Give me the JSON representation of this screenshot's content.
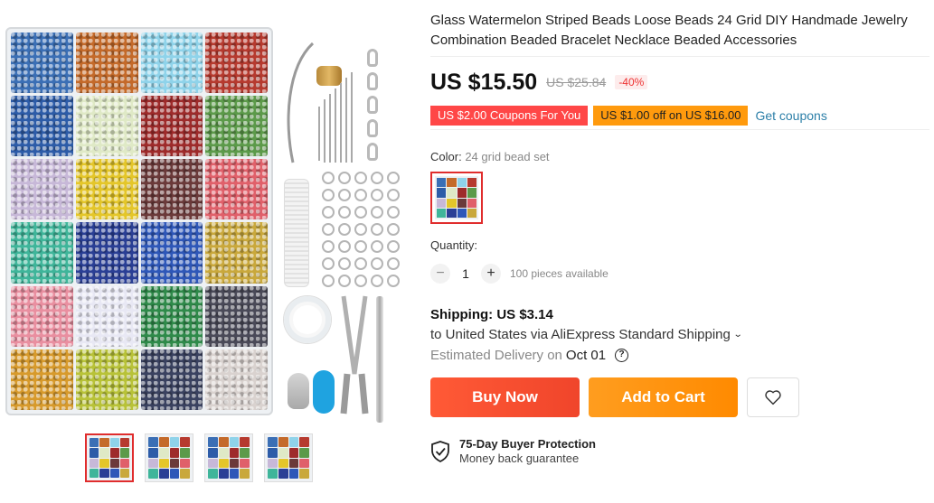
{
  "product": {
    "title": "Glass Watermelon Striped Beads Loose Beads 24 Grid DIY Handmade Jewelry Combination Beaded Bracelet Necklace Beaded Accessories",
    "price": "US $15.50",
    "original_price": "US $25.84",
    "discount": "-40%"
  },
  "coupons": {
    "coupon1": "US $2.00 Coupons For You",
    "coupon2": "US $1.00 off on US $16.00",
    "get_coupons": "Get coupons"
  },
  "color": {
    "label": "Color:",
    "value": "24 grid bead set"
  },
  "quantity": {
    "label": "Quantity:",
    "minus": "−",
    "plus": "+",
    "value": "1",
    "available": "100 pieces available"
  },
  "shipping": {
    "title": "Shipping: US $3.14",
    "destination": "to United States via AliExpress Standard Shipping",
    "delivery_label": "Estimated Delivery on",
    "delivery_date": "Oct 01",
    "help": "?"
  },
  "actions": {
    "buy_now": "Buy Now",
    "add_to_cart": "Add to Cart"
  },
  "protection": {
    "title": "75-Day Buyer Protection",
    "subtitle": "Money back guarantee"
  },
  "colors": {
    "accent_red": "#ff4747",
    "accent_orange": "#ff9a0d",
    "buy_button": "#f0452b",
    "cart_button": "#ff8a00",
    "link": "#2c7fa8"
  },
  "icons": {
    "dropdown": "chevron-down-icon",
    "help": "question-circle-icon",
    "wishlist": "heart-icon",
    "protection": "shield-check-icon"
  }
}
